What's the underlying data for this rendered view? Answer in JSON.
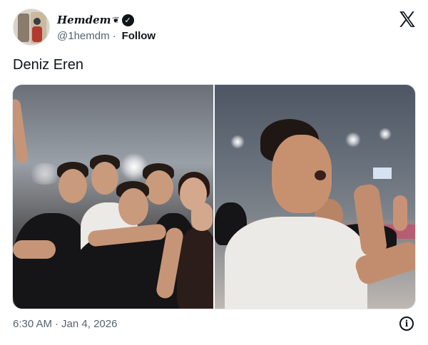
{
  "author": {
    "display_name": "Hemdem",
    "emoji": "❦",
    "handle": "@1hemdm",
    "follow_label": "Follow",
    "separator": "·"
  },
  "tweet": {
    "text": "Deniz Eren"
  },
  "footer": {
    "time": "6:30 AM",
    "separator": "·",
    "date": "Jan 4, 2026"
  },
  "icons": {
    "verified": "verified-badge",
    "platform": "x-logo",
    "info": "info-icon"
  },
  "colors": {
    "text_primary": "#0f1419",
    "text_secondary": "#536471"
  }
}
